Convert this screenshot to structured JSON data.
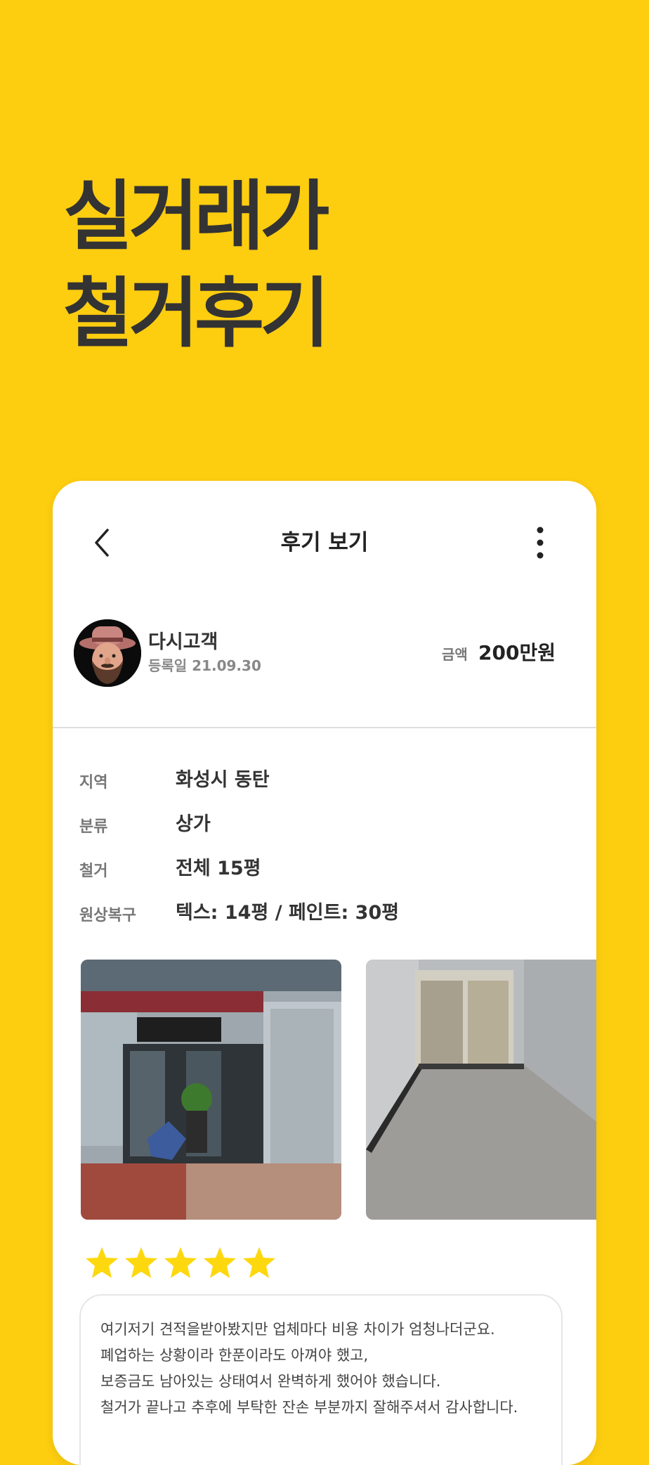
{
  "headline": {
    "line1": "실거래가",
    "line2": "철거후기"
  },
  "header": {
    "title": "후기 보기",
    "back_icon": "chevron-left-icon",
    "more_icon": "vertical-dots-icon"
  },
  "profile": {
    "name": "다시고객",
    "date": "등록일 21.09.30",
    "amount_label": "금액",
    "amount": "200만원"
  },
  "details": [
    {
      "label": "지역",
      "value": "화성시 동탄"
    },
    {
      "label": "분류",
      "value": "상가"
    },
    {
      "label": "철거",
      "value": "전체 15평"
    },
    {
      "label": "원상복구",
      "value": "텍스: 14평 / 페인트: 30평"
    }
  ],
  "rating": {
    "stars": 5,
    "color": "#FDD80F"
  },
  "review": {
    "lines": [
      "여기저기 견적을받아봤지만 업체마다 비용 차이가 엄청나더군요.",
      "폐업하는 상황이라 한푼이라도 아껴야 했고,",
      "보증금도 남아있는 상태여서 완벽하게 했어야 했습니다.",
      "철거가 끝나고 추후에 부탁한 잔손 부분까지 잘해주셔서 감사합니다."
    ]
  },
  "colors": {
    "background": "#FDCD10",
    "text_dark": "#333333"
  }
}
